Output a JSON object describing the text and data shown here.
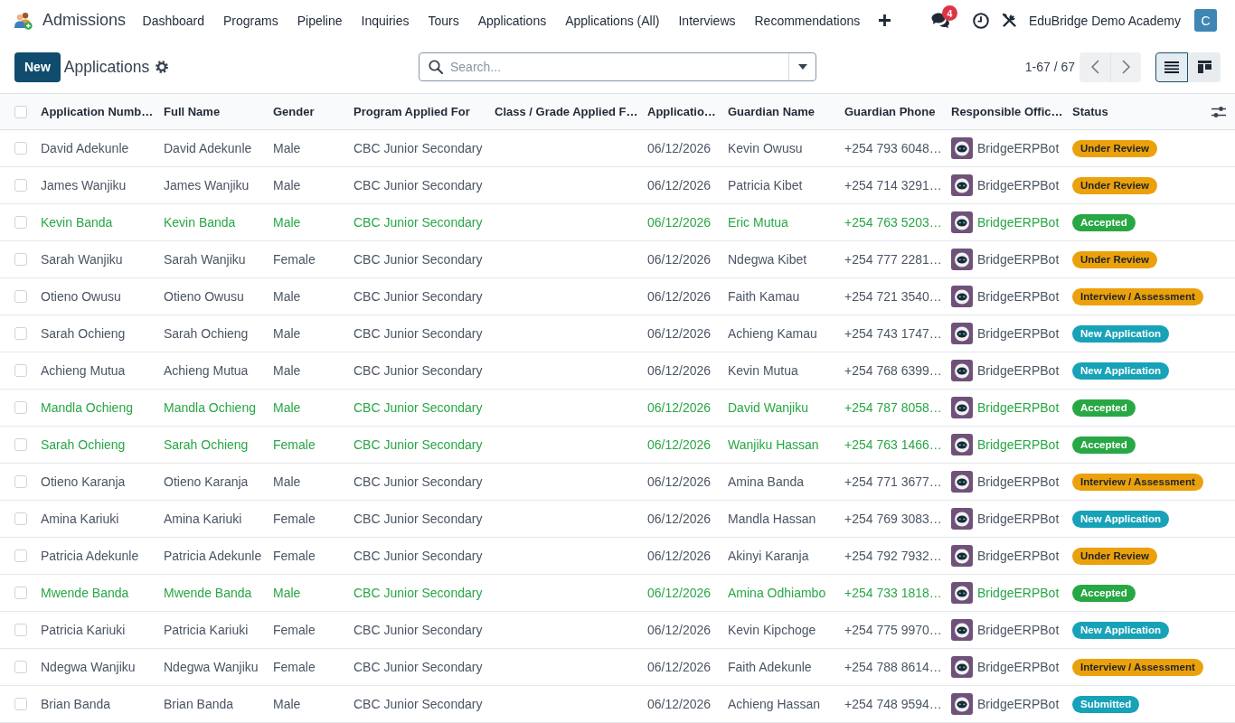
{
  "navbar": {
    "app_name": "Admissions",
    "menu": [
      "Dashboard",
      "Programs",
      "Pipeline",
      "Inquiries",
      "Tours",
      "Applications",
      "Applications (All)",
      "Interviews",
      "Recommendations"
    ],
    "message_count": "4",
    "company": "EduBridge Demo Academy",
    "user_initial": "C"
  },
  "control_panel": {
    "new_button": "New",
    "title": "Applications",
    "search": {
      "placeholder": "Search..."
    },
    "pager": "1-67 / 67",
    "views": [
      {
        "kind": "list",
        "selected": true
      },
      {
        "kind": "kanban",
        "selected": false
      }
    ]
  },
  "table": {
    "select_all_checked": false,
    "columns": [
      "Application Numb…",
      "Full Name",
      "Gender",
      "Program Applied For",
      "Class / Grade Applied F…",
      "Applicatio…",
      "Guardian Name",
      "Guardian Phone",
      "Responsible Offic…",
      "Status"
    ],
    "rows": [
      {
        "selected": false,
        "highlighted": false,
        "application_number": "David Adekunle",
        "full_name": "David Adekunle",
        "gender": "Male",
        "program_applied_for": "CBC Junior Secondary",
        "application_date": "06/12/2026",
        "guardian_name": "Kevin Owusu",
        "guardian_phone": "+254 793 6048…",
        "responsible_officer": "BridgeERPBot",
        "status": {
          "label": "Under Review",
          "color": "#eba10c"
        }
      },
      {
        "selected": false,
        "highlighted": false,
        "application_number": "James Wanjiku",
        "full_name": "James Wanjiku",
        "gender": "Male",
        "program_applied_for": "CBC Junior Secondary",
        "application_date": "06/12/2026",
        "guardian_name": "Patricia Kibet",
        "guardian_phone": "+254 714 3291…",
        "responsible_officer": "BridgeERPBot",
        "status": {
          "label": "Under Review",
          "color": "#eba10c"
        }
      },
      {
        "selected": false,
        "highlighted": true,
        "application_number": "Kevin Banda",
        "full_name": "Kevin Banda",
        "gender": "Male",
        "program_applied_for": "CBC Junior Secondary",
        "application_date": "06/12/2026",
        "guardian_name": "Eric Mutua",
        "guardian_phone": "+254 763 5203…",
        "responsible_officer": "BridgeERPBot",
        "status": {
          "label": "Accepted",
          "color": "#28a745"
        }
      },
      {
        "selected": false,
        "highlighted": false,
        "application_number": "Sarah Wanjiku",
        "full_name": "Sarah Wanjiku",
        "gender": "Female",
        "program_applied_for": "CBC Junior Secondary",
        "application_date": "06/12/2026",
        "guardian_name": "Ndegwa Kibet",
        "guardian_phone": "+254 777 2281…",
        "responsible_officer": "BridgeERPBot",
        "status": {
          "label": "Under Review",
          "color": "#eba10c"
        }
      },
      {
        "selected": false,
        "highlighted": false,
        "application_number": "Otieno Owusu",
        "full_name": "Otieno Owusu",
        "gender": "Male",
        "program_applied_for": "CBC Junior Secondary",
        "application_date": "06/12/2026",
        "guardian_name": "Faith Kamau",
        "guardian_phone": "+254 721 3540…",
        "responsible_officer": "BridgeERPBot",
        "status": {
          "label": "Interview / Assessment",
          "color": "#eba10c"
        }
      },
      {
        "selected": false,
        "highlighted": false,
        "application_number": "Sarah Ochieng",
        "full_name": "Sarah Ochieng",
        "gender": "Male",
        "program_applied_for": "CBC Junior Secondary",
        "application_date": "06/12/2026",
        "guardian_name": "Achieng Kamau",
        "guardian_phone": "+254 743 1747…",
        "responsible_officer": "BridgeERPBot",
        "status": {
          "label": "New Application",
          "color": "#17a2b8"
        }
      },
      {
        "selected": false,
        "highlighted": false,
        "application_number": "Achieng Mutua",
        "full_name": "Achieng Mutua",
        "gender": "Male",
        "program_applied_for": "CBC Junior Secondary",
        "application_date": "06/12/2026",
        "guardian_name": "Kevin Mutua",
        "guardian_phone": "+254 768 6399…",
        "responsible_officer": "BridgeERPBot",
        "status": {
          "label": "New Application",
          "color": "#17a2b8"
        }
      },
      {
        "selected": false,
        "highlighted": true,
        "application_number": "Mandla Ochieng",
        "full_name": "Mandla Ochieng",
        "gender": "Male",
        "program_applied_for": "CBC Junior Secondary",
        "application_date": "06/12/2026",
        "guardian_name": "David Wanjiku",
        "guardian_phone": "+254 787 8058…",
        "responsible_officer": "BridgeERPBot",
        "status": {
          "label": "Accepted",
          "color": "#28a745"
        }
      },
      {
        "selected": false,
        "highlighted": true,
        "application_number": "Sarah Ochieng",
        "full_name": "Sarah Ochieng",
        "gender": "Female",
        "program_applied_for": "CBC Junior Secondary",
        "application_date": "06/12/2026",
        "guardian_name": "Wanjiku Hassan",
        "guardian_phone": "+254 763 1466…",
        "responsible_officer": "BridgeERPBot",
        "status": {
          "label": "Accepted",
          "color": "#28a745"
        }
      },
      {
        "selected": false,
        "highlighted": false,
        "application_number": "Otieno Karanja",
        "full_name": "Otieno Karanja",
        "gender": "Male",
        "program_applied_for": "CBC Junior Secondary",
        "application_date": "06/12/2026",
        "guardian_name": "Amina Banda",
        "guardian_phone": "+254 771 3677…",
        "responsible_officer": "BridgeERPBot",
        "status": {
          "label": "Interview / Assessment",
          "color": "#eba10c"
        }
      },
      {
        "selected": false,
        "highlighted": false,
        "application_number": "Amina Kariuki",
        "full_name": "Amina Kariuki",
        "gender": "Female",
        "program_applied_for": "CBC Junior Secondary",
        "application_date": "06/12/2026",
        "guardian_name": "Mandla Hassan",
        "guardian_phone": "+254 769 3083…",
        "responsible_officer": "BridgeERPBot",
        "status": {
          "label": "New Application",
          "color": "#17a2b8"
        }
      },
      {
        "selected": false,
        "highlighted": false,
        "application_number": "Patricia Adekunle",
        "full_name": "Patricia Adekunle",
        "gender": "Female",
        "program_applied_for": "CBC Junior Secondary",
        "application_date": "06/12/2026",
        "guardian_name": "Akinyi Karanja",
        "guardian_phone": "+254 792 7932…",
        "responsible_officer": "BridgeERPBot",
        "status": {
          "label": "Under Review",
          "color": "#eba10c"
        }
      },
      {
        "selected": false,
        "highlighted": true,
        "application_number": "Mwende Banda",
        "full_name": "Mwende Banda",
        "gender": "Male",
        "program_applied_for": "CBC Junior Secondary",
        "application_date": "06/12/2026",
        "guardian_name": "Amina Odhiambo",
        "guardian_phone": "+254 733 1818…",
        "responsible_officer": "BridgeERPBot",
        "status": {
          "label": "Accepted",
          "color": "#28a745"
        }
      },
      {
        "selected": false,
        "highlighted": false,
        "application_number": "Patricia Kariuki",
        "full_name": "Patricia Kariuki",
        "gender": "Female",
        "program_applied_for": "CBC Junior Secondary",
        "application_date": "06/12/2026",
        "guardian_name": "Kevin Kipchoge",
        "guardian_phone": "+254 775 9970…",
        "responsible_officer": "BridgeERPBot",
        "status": {
          "label": "New Application",
          "color": "#17a2b8"
        }
      },
      {
        "selected": false,
        "highlighted": false,
        "application_number": "Ndegwa Wanjiku",
        "full_name": "Ndegwa Wanjiku",
        "gender": "Female",
        "program_applied_for": "CBC Junior Secondary",
        "application_date": "06/12/2026",
        "guardian_name": "Faith Adekunle",
        "guardian_phone": "+254 788 8614…",
        "responsible_officer": "BridgeERPBot",
        "status": {
          "label": "Interview / Assessment",
          "color": "#eba10c"
        }
      },
      {
        "selected": false,
        "highlighted": false,
        "application_number": "Brian Banda",
        "full_name": "Brian Banda",
        "gender": "Male",
        "program_applied_for": "CBC Junior Secondary",
        "application_date": "06/12/2026",
        "guardian_name": "Achieng Hassan",
        "guardian_phone": "+254 748 9594…",
        "responsible_officer": "BridgeERPBot",
        "status": {
          "label": "Submitted",
          "color": "#17a2b8"
        }
      }
    ]
  }
}
